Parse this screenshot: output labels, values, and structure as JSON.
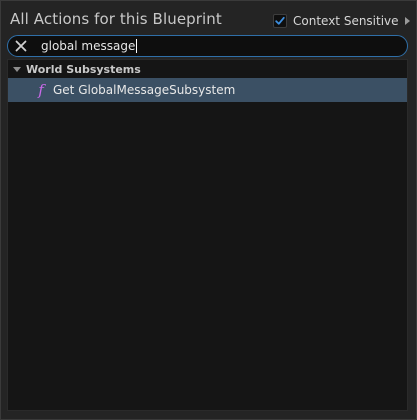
{
  "window": {
    "title": "All Actions for this Blueprint"
  },
  "context_sensitive": {
    "label": "Context Sensitive",
    "checked": true
  },
  "search": {
    "value": "global message"
  },
  "results": {
    "categories": [
      {
        "label": "World Subsystems",
        "expanded": true,
        "items": [
          {
            "icon": "function-icon",
            "glyph": "f",
            "label": "Get GlobalMessageSubsystem",
            "selected": true
          }
        ]
      }
    ]
  },
  "colors": {
    "accent_blue": "#2f6fa8",
    "selection": "#3b5064",
    "function_icon": "#c869e8"
  }
}
